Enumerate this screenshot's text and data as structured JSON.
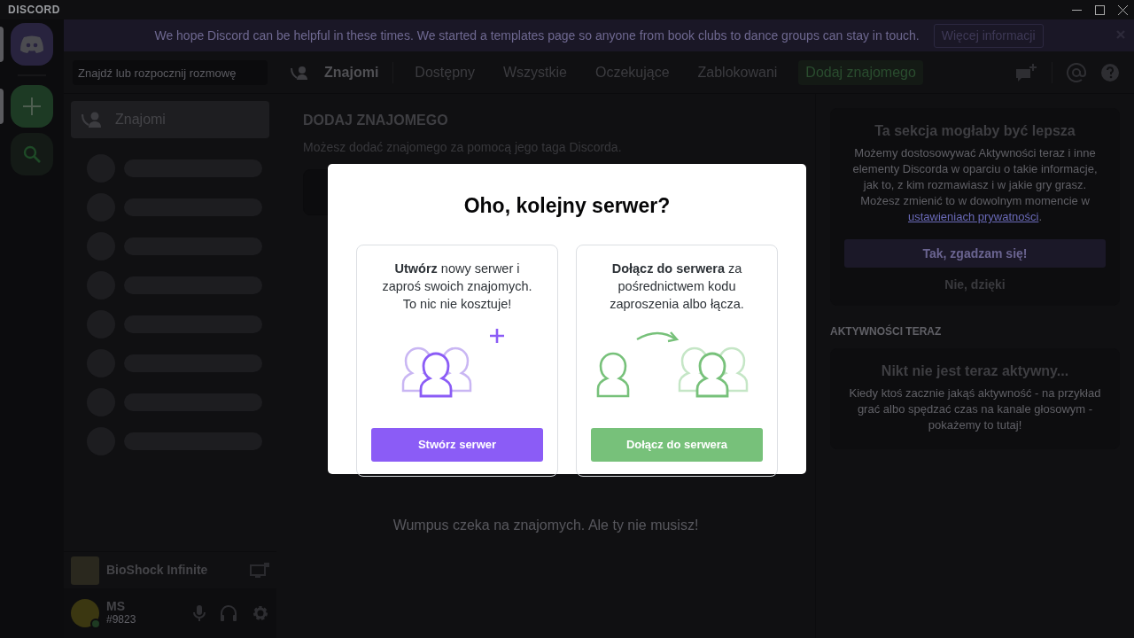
{
  "title_bar": {
    "logo": "DISCORD"
  },
  "servers": [
    {
      "kind": "home",
      "indicator": true
    },
    {
      "kind": "add",
      "indicator": true
    },
    {
      "kind": "explore",
      "indicator": false
    }
  ],
  "banner": {
    "text": "We hope Discord can be helpful in these times. We started a templates page so anyone from book clubs to dance groups can stay in touch.",
    "button": "Więcej informacji"
  },
  "dm_sidebar": {
    "search": {
      "placeholder": "Znajdź lub rozpocznij rozmowę"
    },
    "items": [
      {
        "label": "Znajomi",
        "selected": true
      }
    ]
  },
  "game_activity": {
    "name": "BioShock Infinite"
  },
  "user_panel": {
    "name": "MS",
    "tag": "#9823"
  },
  "header": {
    "title": "Znajomi",
    "tabs": [
      {
        "label": "Dostępny",
        "kind": "tab",
        "selected": false
      },
      {
        "label": "Wszystkie",
        "kind": "tab",
        "selected": false
      },
      {
        "label": "Oczekujące",
        "kind": "tab",
        "selected": false
      },
      {
        "label": "Zablokowani",
        "kind": "tab",
        "selected": false
      },
      {
        "label": "Dodaj znajomego",
        "kind": "add",
        "selected": true
      }
    ]
  },
  "add_friend": {
    "heading": "DODAJ ZNAJOMEGO",
    "description": "Możesz dodać znajomego za pomocą jego taga Discorda.",
    "empty_text": "Wumpus czeka na znajomych. Ale ty nie musisz!"
  },
  "activity_panel": {
    "card": {
      "title": "Ta sekcja mogłaby być lepsza",
      "text": "Możemy dostosowywać Aktywności teraz i inne elementy Discorda w oparciu o takie informacje, jak to, z kim rozmawiasz i w jakie gry grasz. Możesz zmienić to w dowolnym momencie w",
      "link": "ustawieniach prywatności",
      "suffix": ".",
      "accept": "Tak, zgadzam się!",
      "decline": "Nie, dzięki"
    },
    "heading": "AKTYWNOŚCI TERAZ",
    "empty": {
      "title": "Nikt nie jest teraz aktywny...",
      "text": "Kiedy ktoś zacznie jakąś aktywność - na przykład grać albo spędzać czas na kanale głosowym - pokażemy to tutaj!"
    }
  },
  "modal": {
    "title": "Oho, kolejny serwer?",
    "options": [
      {
        "kind": "create",
        "text": "**Utwórz** nowy serwer i zaproś swoich znajomych. To nic nie kosztuje!",
        "button": "Stwórz serwer"
      },
      {
        "kind": "join",
        "text": "**Dołącz do serwera** za pośrednictwem kodu zaproszenia albo łącza.",
        "button": "Dołącz do serwera"
      }
    ]
  }
}
